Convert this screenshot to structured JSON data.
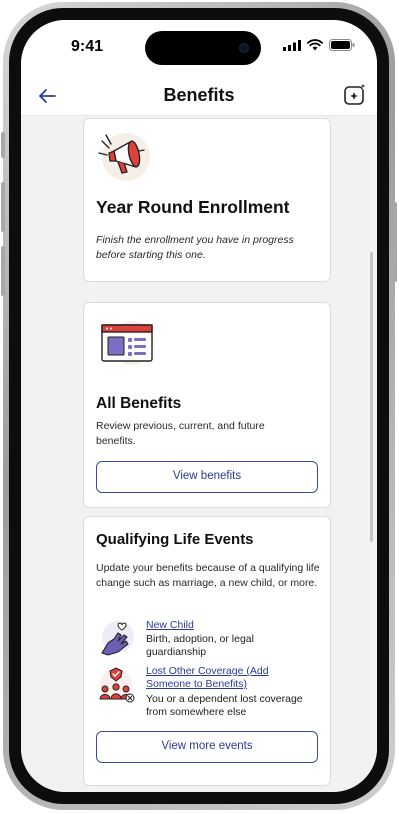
{
  "status_bar": {
    "time": "9:41"
  },
  "nav": {
    "title": "Benefits"
  },
  "enrollment_card": {
    "title": "Year Round Enrollment",
    "description": "Finish the enrollment you have in progress before starting this one."
  },
  "all_benefits_card": {
    "title": "All Benefits",
    "description": "Review previous, current, and future benefits.",
    "button_label": "View benefits"
  },
  "life_events_card": {
    "title": "Qualifying Life Events",
    "description": "Update your benefits because of a qualifying life change such as marriage, a new child, or more.",
    "events": [
      {
        "link": "New Child",
        "description": "Birth, adoption, or legal guardianship",
        "icon": "hand-heart-icon"
      },
      {
        "link": "Lost Other Coverage (Add Someone to Benefits)",
        "description": "You or a dependent lost coverage from somewhere else",
        "icon": "family-shield-icon"
      }
    ],
    "button_label": "View more events"
  },
  "colors": {
    "accent": "#2c3a96",
    "brand_red": "#e0403a",
    "purple": "#6b5fb5"
  }
}
